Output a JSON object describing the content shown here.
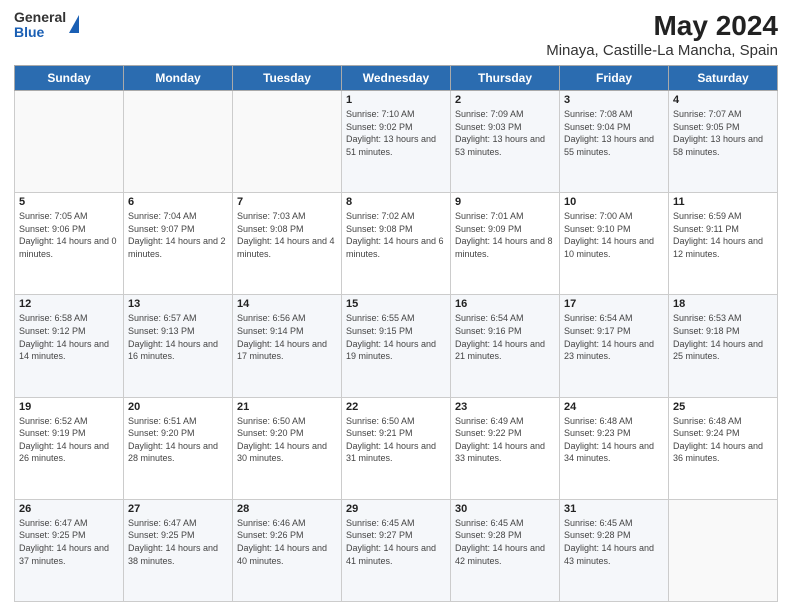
{
  "header": {
    "logo_general": "General",
    "logo_blue": "Blue",
    "title": "May 2024",
    "subtitle": "Minaya, Castille-La Mancha, Spain"
  },
  "days_of_week": [
    "Sunday",
    "Monday",
    "Tuesday",
    "Wednesday",
    "Thursday",
    "Friday",
    "Saturday"
  ],
  "weeks": [
    [
      {
        "day": "",
        "info": ""
      },
      {
        "day": "",
        "info": ""
      },
      {
        "day": "",
        "info": ""
      },
      {
        "day": "1",
        "info": "Sunrise: 7:10 AM\nSunset: 9:02 PM\nDaylight: 13 hours and 51 minutes."
      },
      {
        "day": "2",
        "info": "Sunrise: 7:09 AM\nSunset: 9:03 PM\nDaylight: 13 hours and 53 minutes."
      },
      {
        "day": "3",
        "info": "Sunrise: 7:08 AM\nSunset: 9:04 PM\nDaylight: 13 hours and 55 minutes."
      },
      {
        "day": "4",
        "info": "Sunrise: 7:07 AM\nSunset: 9:05 PM\nDaylight: 13 hours and 58 minutes."
      }
    ],
    [
      {
        "day": "5",
        "info": "Sunrise: 7:05 AM\nSunset: 9:06 PM\nDaylight: 14 hours and 0 minutes."
      },
      {
        "day": "6",
        "info": "Sunrise: 7:04 AM\nSunset: 9:07 PM\nDaylight: 14 hours and 2 minutes."
      },
      {
        "day": "7",
        "info": "Sunrise: 7:03 AM\nSunset: 9:08 PM\nDaylight: 14 hours and 4 minutes."
      },
      {
        "day": "8",
        "info": "Sunrise: 7:02 AM\nSunset: 9:08 PM\nDaylight: 14 hours and 6 minutes."
      },
      {
        "day": "9",
        "info": "Sunrise: 7:01 AM\nSunset: 9:09 PM\nDaylight: 14 hours and 8 minutes."
      },
      {
        "day": "10",
        "info": "Sunrise: 7:00 AM\nSunset: 9:10 PM\nDaylight: 14 hours and 10 minutes."
      },
      {
        "day": "11",
        "info": "Sunrise: 6:59 AM\nSunset: 9:11 PM\nDaylight: 14 hours and 12 minutes."
      }
    ],
    [
      {
        "day": "12",
        "info": "Sunrise: 6:58 AM\nSunset: 9:12 PM\nDaylight: 14 hours and 14 minutes."
      },
      {
        "day": "13",
        "info": "Sunrise: 6:57 AM\nSunset: 9:13 PM\nDaylight: 14 hours and 16 minutes."
      },
      {
        "day": "14",
        "info": "Sunrise: 6:56 AM\nSunset: 9:14 PM\nDaylight: 14 hours and 17 minutes."
      },
      {
        "day": "15",
        "info": "Sunrise: 6:55 AM\nSunset: 9:15 PM\nDaylight: 14 hours and 19 minutes."
      },
      {
        "day": "16",
        "info": "Sunrise: 6:54 AM\nSunset: 9:16 PM\nDaylight: 14 hours and 21 minutes."
      },
      {
        "day": "17",
        "info": "Sunrise: 6:54 AM\nSunset: 9:17 PM\nDaylight: 14 hours and 23 minutes."
      },
      {
        "day": "18",
        "info": "Sunrise: 6:53 AM\nSunset: 9:18 PM\nDaylight: 14 hours and 25 minutes."
      }
    ],
    [
      {
        "day": "19",
        "info": "Sunrise: 6:52 AM\nSunset: 9:19 PM\nDaylight: 14 hours and 26 minutes."
      },
      {
        "day": "20",
        "info": "Sunrise: 6:51 AM\nSunset: 9:20 PM\nDaylight: 14 hours and 28 minutes."
      },
      {
        "day": "21",
        "info": "Sunrise: 6:50 AM\nSunset: 9:20 PM\nDaylight: 14 hours and 30 minutes."
      },
      {
        "day": "22",
        "info": "Sunrise: 6:50 AM\nSunset: 9:21 PM\nDaylight: 14 hours and 31 minutes."
      },
      {
        "day": "23",
        "info": "Sunrise: 6:49 AM\nSunset: 9:22 PM\nDaylight: 14 hours and 33 minutes."
      },
      {
        "day": "24",
        "info": "Sunrise: 6:48 AM\nSunset: 9:23 PM\nDaylight: 14 hours and 34 minutes."
      },
      {
        "day": "25",
        "info": "Sunrise: 6:48 AM\nSunset: 9:24 PM\nDaylight: 14 hours and 36 minutes."
      }
    ],
    [
      {
        "day": "26",
        "info": "Sunrise: 6:47 AM\nSunset: 9:25 PM\nDaylight: 14 hours and 37 minutes."
      },
      {
        "day": "27",
        "info": "Sunrise: 6:47 AM\nSunset: 9:25 PM\nDaylight: 14 hours and 38 minutes."
      },
      {
        "day": "28",
        "info": "Sunrise: 6:46 AM\nSunset: 9:26 PM\nDaylight: 14 hours and 40 minutes."
      },
      {
        "day": "29",
        "info": "Sunrise: 6:45 AM\nSunset: 9:27 PM\nDaylight: 14 hours and 41 minutes."
      },
      {
        "day": "30",
        "info": "Sunrise: 6:45 AM\nSunset: 9:28 PM\nDaylight: 14 hours and 42 minutes."
      },
      {
        "day": "31",
        "info": "Sunrise: 6:45 AM\nSunset: 9:28 PM\nDaylight: 14 hours and 43 minutes."
      },
      {
        "day": "",
        "info": ""
      }
    ]
  ]
}
